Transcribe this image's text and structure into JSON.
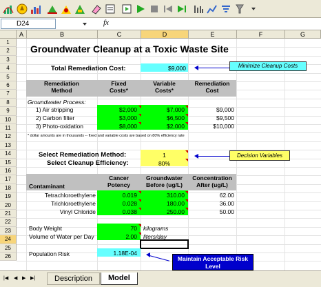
{
  "toolbar": {
    "icons": [
      "add-assumption-icon",
      "define-decision-icon",
      "define-forecast-icon",
      "copy-data-icon",
      "paste-data-icon",
      "clear-data-icon",
      "cell-preferences-icon",
      "run-preferences-icon",
      "start-simulation-icon",
      "stop-simulation-icon",
      "reset-simulation-icon",
      "single-step-icon",
      "optquest-icon",
      "view-charts-icon",
      "sensitivity-icon",
      "tools-icon",
      "toolbar-options-icon"
    ]
  },
  "formula_bar": {
    "cell_ref": "D24",
    "fx_label": "fx",
    "formula": ""
  },
  "columns": [
    "A",
    "B",
    "C",
    "D",
    "E",
    "F",
    "G"
  ],
  "active_column": "D",
  "rows": [
    "1",
    "2",
    "3",
    "4",
    "5",
    "6",
    "7",
    "8",
    "9",
    "10",
    "11",
    "12",
    "13",
    "14",
    "15",
    "16",
    "17",
    "18",
    "19",
    "20",
    "21",
    "22",
    "23",
    "24",
    "25",
    "26"
  ],
  "active_row": "24",
  "sheet": {
    "title": "Groundwater Cleanup at a Toxic Waste Site",
    "total_cost_label": "Total Remediation Cost:",
    "total_cost_value": "$9,000",
    "minimize_callout": "Minimize Cleanup Costs",
    "method_header": {
      "l1": "Remediation",
      "l2": "Method"
    },
    "fixed_header": {
      "l1": "Fixed",
      "l2": "Costs*"
    },
    "variable_header": {
      "l1": "Variable",
      "l2": "Costs*"
    },
    "cost_header": {
      "l1": "Remediation",
      "l2": "Cost"
    },
    "process_label": "Groundwater Process:",
    "methods": [
      {
        "name": "1) Air stripping",
        "fixed": "$2,000",
        "variable": "$7,000",
        "cost": "$9,000"
      },
      {
        "name": "2) Carbon filter",
        "fixed": "$3,000",
        "variable": "$6,500",
        "cost": "$9,500"
      },
      {
        "name": "3) Photo-oxidation",
        "fixed": "$8,000",
        "variable": "$2,000",
        "cost": "$10,000"
      }
    ],
    "footnote": "* dollar amounts are in thousands -- fixed and variable costs are based on 80% efficiency rate",
    "select_method_label": "Select Remediation Method:",
    "select_method_value": "1",
    "select_eff_label": "Select Cleanup Efficiency:",
    "select_eff_value": "80%",
    "decision_callout": "Decision Variables",
    "contam_headers": {
      "contaminant": "Contaminant",
      "potency_l1": "Cancer",
      "potency_l2": "Potency",
      "before_l1": "Groundwater",
      "before_l2": "Before (ug/L)",
      "after_l1": "Concentration",
      "after_l2": "After (ug/L)"
    },
    "contaminants": [
      {
        "name": "Tetrachloroethylene",
        "potency": "0.019",
        "before": "310.00",
        "after": "62.00"
      },
      {
        "name": "Trichloroethylene",
        "potency": "0.028",
        "before": "180.00",
        "after": "36.00"
      },
      {
        "name": "Vinyl Chloride",
        "potency": "0.038",
        "before": "250.00",
        "after": "50.00"
      }
    ],
    "body_weight_label": "Body Weight",
    "body_weight_value": "70",
    "body_weight_unit": "kilograms",
    "water_label": "Volume of Water per Day",
    "water_value": "2.00",
    "water_unit": "liters/day",
    "risk_label": "Population Risk",
    "risk_value": "1.18E-04",
    "risk_callout": "Maintain Acceptable Risk Level"
  },
  "tabs": {
    "description": "Description",
    "model": "Model"
  },
  "colors": {
    "green": "#00ff00",
    "cyan": "#66ffff",
    "yellow": "#ffff66",
    "gray": "#c0c0c0",
    "navy": "#0000cc"
  }
}
